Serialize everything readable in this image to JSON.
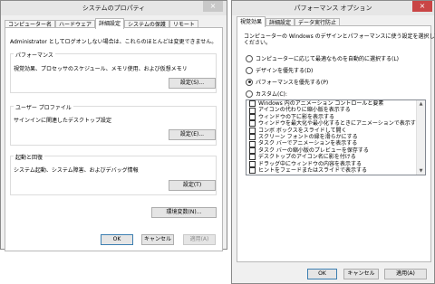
{
  "sys": {
    "title": "システムのプロパティ",
    "close": "×",
    "tabs": [
      "コンピューター名",
      "ハードウェア",
      "詳細設定",
      "システムの保護",
      "リモート"
    ],
    "admin_note": "Administrator としてログオンしない場合は、これらのほとんどは変更できません。",
    "performance": {
      "label": "パフォーマンス",
      "desc": "視覚効果、プロセッサのスケジュール、メモリ使用、および仮想メモリ",
      "button": "設定(S)..."
    },
    "profile": {
      "label": "ユーザー プロファイル",
      "desc": "サインインに関連したデスクトップ設定",
      "button": "設定(E)..."
    },
    "startup": {
      "label": "起動と回復",
      "desc": "システム起動、システム障害、およびデバッグ情報",
      "button": "設定(T)"
    },
    "env_button": "環境変数(N)...",
    "ok": "OK",
    "cancel": "キャンセル",
    "apply": "適用(A)"
  },
  "perf": {
    "title": "パフォーマンス オプション",
    "close": "×",
    "tabs": [
      "視覚効果",
      "詳細設定",
      "データ実行防止"
    ],
    "intro_line1": "コンピューターの Windows のデザインとパフォーマンスに使う設定を選択して",
    "intro_line2": "ください。",
    "radios": [
      {
        "label": "コンピューターに応じて最適なものを自動的に選択する(L)",
        "selected": false
      },
      {
        "label": "デザインを優先する(D)",
        "selected": false
      },
      {
        "label": "パフォーマンスを優先する(P)",
        "selected": true
      },
      {
        "label": "カスタム(C):",
        "selected": false
      }
    ],
    "effects": [
      "Windows 内のアニメーション コントロールと要素",
      "アイコンの代わりに縮小版を表示する",
      "ウィンドウの下に影を表示する",
      "ウィンドウを最大化や最小化するときにアニメーションで表示する",
      "コンボ ボックスをスライドして開く",
      "スクリーン フォントの縁を滑らかにする",
      "タスク バーでアニメーションを表示する",
      "タスク バーの縮小版のプレビューを保存する",
      "デスクトップのアイコン名に影を付ける",
      "ドラッグ中にウィンドウの内容を表示する",
      "ヒントをフェードまたはスライドで表示する"
    ],
    "ok": "OK",
    "cancel": "キャンセル",
    "apply": "適用(A)"
  }
}
